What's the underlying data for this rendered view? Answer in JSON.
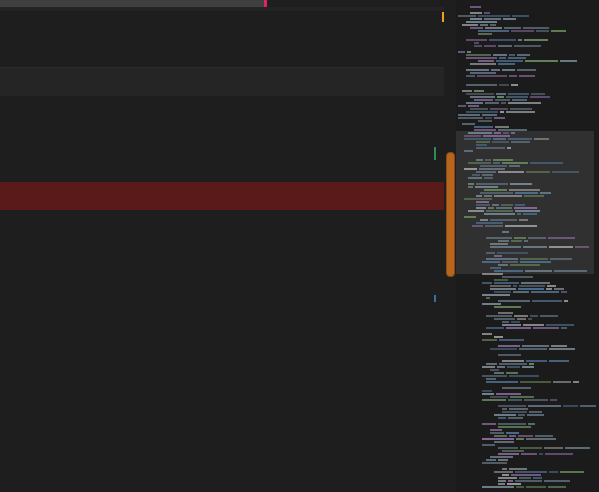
{
  "window": {
    "title": ""
  },
  "editor": {
    "visible_text": "",
    "status": "paused"
  },
  "colors": {
    "background": "#1e1e1e",
    "current_line": "#252525",
    "error_line": "#5a1a1a",
    "scroll_thumb": "#b5651d",
    "scroll_edge": "#e0245e",
    "pause_icon": "#f0a020",
    "git_added": "#2e8b57",
    "git_modified": "#3a6ea5"
  },
  "icons": {
    "pause": "pause-icon"
  }
}
